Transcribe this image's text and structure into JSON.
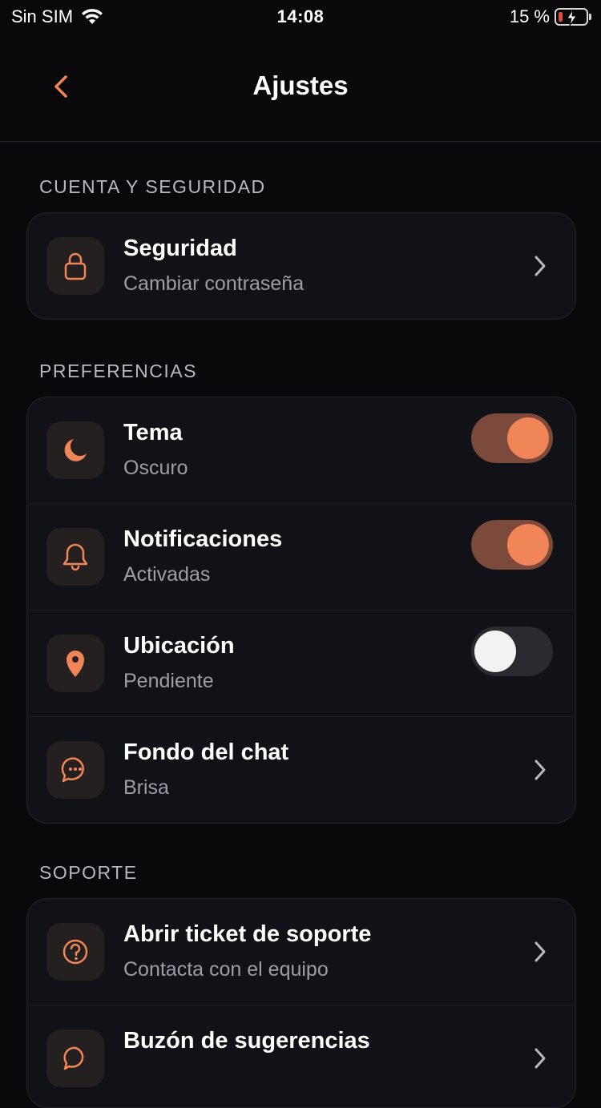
{
  "status_bar": {
    "carrier": "Sin SIM",
    "time": "14:08",
    "battery_percent": "15 %"
  },
  "header": {
    "title": "Ajustes"
  },
  "sections": {
    "account": {
      "label": "CUENTA Y SEGURIDAD",
      "items": [
        {
          "title": "Seguridad",
          "subtitle": "Cambiar contraseña",
          "icon": "lock-icon"
        }
      ]
    },
    "preferences": {
      "label": "PREFERENCIAS",
      "items": [
        {
          "title": "Tema",
          "subtitle": "Oscuro",
          "icon": "moon-icon",
          "toggle": true
        },
        {
          "title": "Notificaciones",
          "subtitle": "Activadas",
          "icon": "bell-icon",
          "toggle": true
        },
        {
          "title": "Ubicación",
          "subtitle": "Pendiente",
          "icon": "location-pin-icon",
          "toggle": false
        },
        {
          "title": "Fondo del chat",
          "subtitle": "Brisa",
          "icon": "chat-bubble-icon"
        }
      ]
    },
    "support": {
      "label": "SOPORTE",
      "items": [
        {
          "title": "Abrir ticket de soporte",
          "subtitle": "Contacta con el equipo",
          "icon": "help-circle-icon"
        },
        {
          "title": "Buzón de sugerencias",
          "subtitle": "",
          "icon": "suggestion-bubble-icon"
        }
      ]
    }
  },
  "colors": {
    "accent": "#f08558",
    "background": "#09090c",
    "card": "#111217",
    "toggle_on_track": "#7b4a3a"
  }
}
